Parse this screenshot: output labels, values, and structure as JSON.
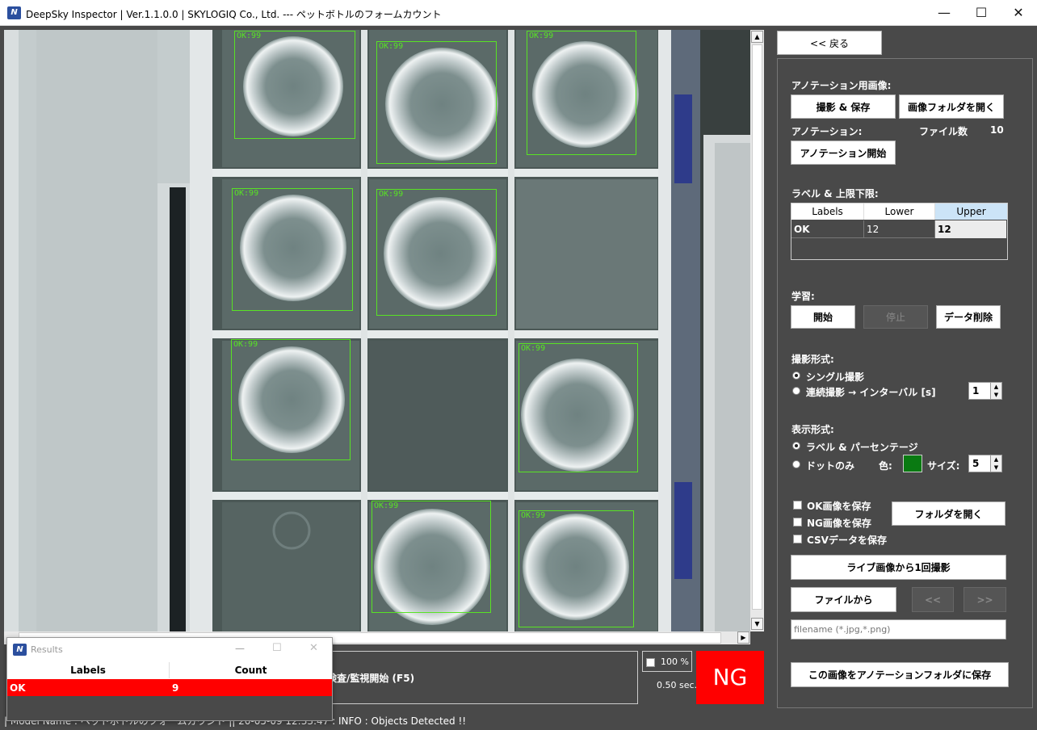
{
  "window": {
    "title": "DeepSky Inspector | Ver.1.1.0.0 | SKYLOGIQ Co., Ltd. --- ペットボトルのフォームカウント",
    "min": "—",
    "max": "☐",
    "close": "✕"
  },
  "back_button": "<< 戻る",
  "annotation": {
    "section_title": "アノテーション用画像:",
    "capture_save": "撮影 & 保存",
    "open_image_folder": "画像フォルダを開く",
    "annotation_label": "アノテーション:",
    "file_count_label": "ファイル数",
    "file_count_value": "10",
    "start_annotation": "アノテーション開始"
  },
  "limits": {
    "section_title": "ラベル & 上限下限:",
    "columns": [
      "Labels",
      "Lower",
      "Upper"
    ],
    "rows": [
      {
        "label": "OK",
        "lower": "12",
        "upper": "12"
      }
    ]
  },
  "training": {
    "section_title": "学習:",
    "start": "開始",
    "stop": "停止",
    "delete_data": "データ削除"
  },
  "capture_mode": {
    "section_title": "撮影形式:",
    "single": "シングル撮影",
    "continuous": "連続撮影 → インターバル [s]",
    "interval_value": "1",
    "selected": "single"
  },
  "display_mode": {
    "section_title": "表示形式:",
    "label_percent": "ラベル & パーセンテージ",
    "dot_only": "ドットのみ",
    "color_label": "色:",
    "color_value": "#0a7a12",
    "size_label": "サイズ:",
    "size_value": "5",
    "selected": "label_percent"
  },
  "save_options": {
    "ok_images": "OK画像を保存",
    "ng_images": "NG画像を保存",
    "csv_data": "CSVデータを保存",
    "open_folder": "フォルダを開く",
    "ok_checked": false,
    "ng_checked": false,
    "csv_checked": false
  },
  "live_capture_once": "ライブ画像から1回撮影",
  "from_file": "ファイルから",
  "prev": "<<",
  "next": ">>",
  "filename_placeholder": "filename (*.jpg,*.png)",
  "save_to_annotation": "この画像をアノテーションフォルダに保存",
  "inspection_button": "検査/監視開始 (F5)",
  "zoom_checkbox_label": "100 %",
  "elapsed": "0.50 sec.",
  "verdict": "NG",
  "verdict_color": "#ff0000",
  "status_bar": "| Model Name : ペットボトルのフォームカウント || 20-05-09 12:33:47 : INFO : Objects Detected !!",
  "detections": [
    {
      "label": "OK:99"
    },
    {
      "label": "OK:99"
    },
    {
      "label": "OK:99"
    },
    {
      "label": "OK:99"
    },
    {
      "label": "OK:99"
    },
    {
      "label": "OK:99"
    },
    {
      "label": "OK:99"
    },
    {
      "label": "OK:99"
    },
    {
      "label": "OK:99"
    }
  ],
  "results_window": {
    "title": "Results",
    "min": "—",
    "max": "☐",
    "close": "✕",
    "columns": [
      "Labels",
      "Count"
    ],
    "rows": [
      {
        "label": "OK",
        "count": "9"
      }
    ]
  }
}
